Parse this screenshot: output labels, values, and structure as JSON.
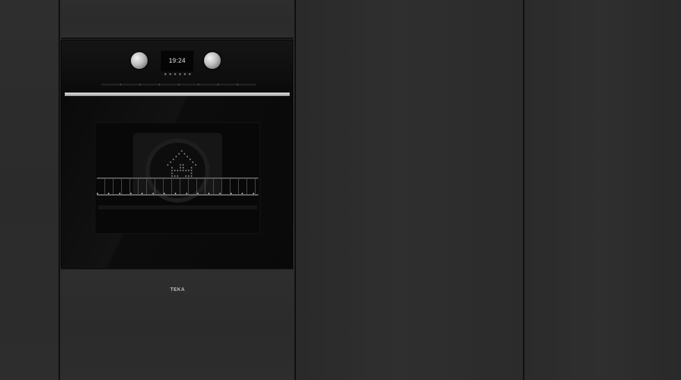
{
  "scene": {
    "oven": {
      "display_time": "19:24",
      "brand_logo": "TEKA",
      "function_icon_count": 6
    },
    "colors": {
      "cabinet": "#2b2b2b",
      "oven_body": "#0b0b0b",
      "trim": "#d4d4d4"
    }
  }
}
